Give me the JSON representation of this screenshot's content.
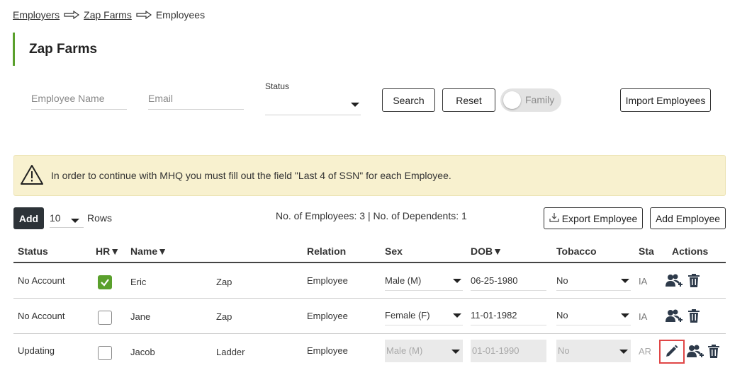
{
  "breadcrumb": {
    "items": [
      "Employers",
      "Zap Farms",
      "Employees"
    ]
  },
  "page": {
    "title": "Zap Farms"
  },
  "filters": {
    "employee_name_placeholder": "Employee Name",
    "email_placeholder": "Email",
    "status_label": "Status",
    "status_value": "",
    "search_label": "Search",
    "reset_label": "Reset",
    "family_toggle_label": "Family",
    "family_toggle_on": false,
    "import_label": "Import Employees"
  },
  "alert": {
    "text": "In order to continue with MHQ you must fill out the field \"Last 4 of SSN\" for each Employee."
  },
  "toolbar": {
    "add_label": "Add",
    "rows_value": "10",
    "rows_label": "Rows",
    "counts_text": "No. of Employees: 3 | No. of Dependents: 1",
    "export_label": "Export Employee",
    "add_employee_label": "Add Employee"
  },
  "table": {
    "headers": {
      "status": "Status",
      "hr": "HR▼",
      "name": "Name▼",
      "relation": "Relation",
      "sex": "Sex",
      "dob": "DOB▼",
      "tobacco": "Tobacco",
      "state": "Sta",
      "actions": "Actions"
    },
    "rows": [
      {
        "status": "No Account",
        "hr": true,
        "first": "Eric",
        "last": "Zap",
        "relation": "Employee",
        "sex": "Male (M)",
        "dob": "06-25-1980",
        "tobacco": "No",
        "state": "IA"
      },
      {
        "status": "No Account",
        "hr": false,
        "first": "Jane",
        "last": "Zap",
        "relation": "Employee",
        "sex": "Female (F)",
        "dob": "11-01-1982",
        "tobacco": "No",
        "state": "IA"
      },
      {
        "status": "Updating",
        "hr": false,
        "first": "Jacob",
        "last": "Ladder",
        "relation": "Employee",
        "sex": "Male (M)",
        "dob": "01-01-1990",
        "tobacco": "No",
        "state": "AR"
      }
    ]
  },
  "colors": {
    "accent_green": "#5aa02c",
    "alert_bg": "#f8f1cf",
    "highlight": "#e04646"
  },
  "icons": [
    "arrow-right-icon",
    "warning-icon",
    "caret-down-icon",
    "checkmark-icon",
    "add-dependent-icon",
    "trash-icon",
    "edit-pencil-icon",
    "download-icon"
  ]
}
